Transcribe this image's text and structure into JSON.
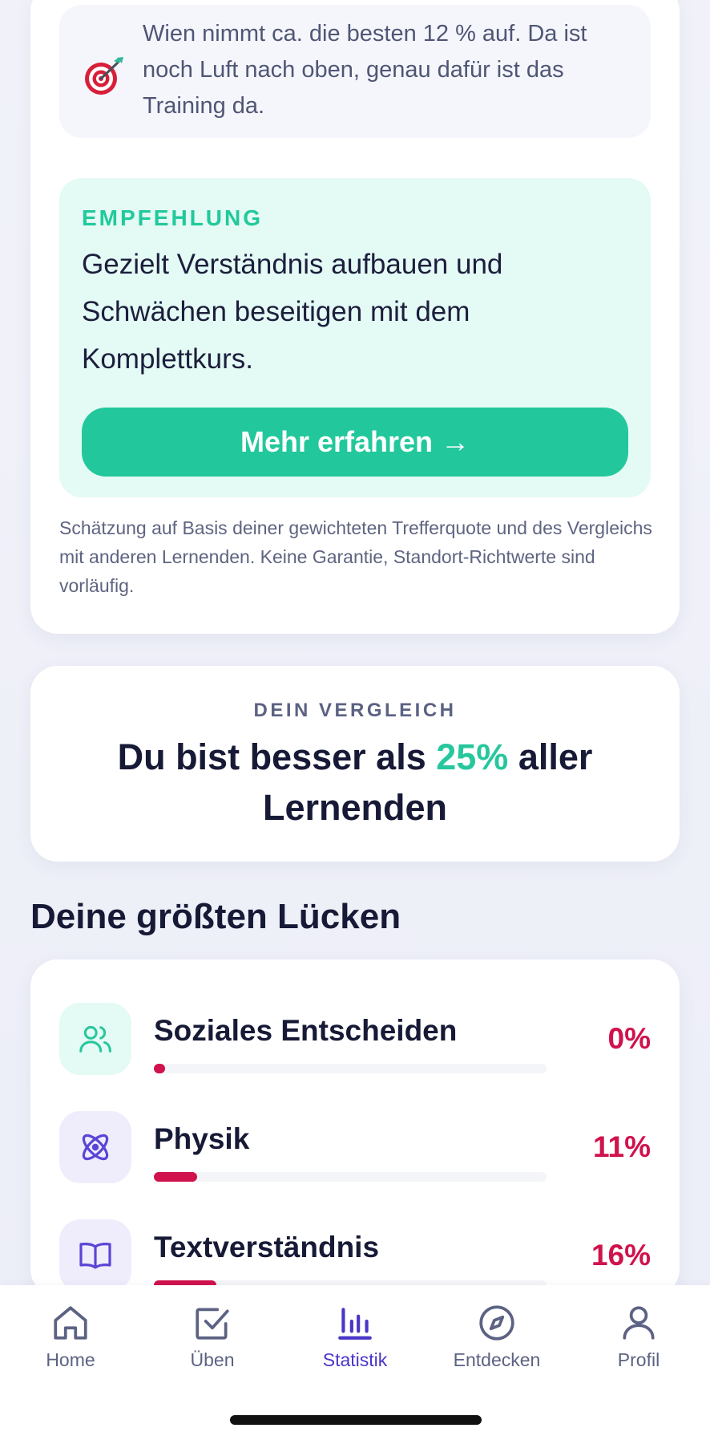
{
  "info": {
    "text": "Wien nimmt ca. die besten 12 % auf. Da ist noch Luft nach oben, genau dafür ist das Training da.",
    "icon": "target-icon"
  },
  "recommendation": {
    "label": "EMPFEHLUNG",
    "text": "Gezielt Verständnis aufbauen und Schwächen beseitigen mit dem Komplettkurs.",
    "button_label": "Mehr erfahren →"
  },
  "disclaimer": "Schätzung auf Basis deiner gewichteten Trefferquote und des Vergleichs mit anderen Lernenden. Keine Garantie, Standort-Richtwerte sind vorläufig.",
  "comparison": {
    "label": "DEIN VERGLEICH",
    "text_before": "Du bist besser als ",
    "percent": "25%",
    "text_after": " aller Lernenden"
  },
  "gaps": {
    "title": "Deine größten Lücken",
    "items": [
      {
        "name": "Soziales Entscheiden",
        "percent_label": "0%",
        "value": 0,
        "icon": "users-icon"
      },
      {
        "name": "Physik",
        "percent_label": "11%",
        "value": 11,
        "icon": "atom-icon"
      },
      {
        "name": "Textverständnis",
        "percent_label": "16%",
        "value": 16,
        "icon": "book-icon"
      }
    ]
  },
  "nav": {
    "items": [
      {
        "label": "Home",
        "icon": "home-icon"
      },
      {
        "label": "Üben",
        "icon": "checkbox-icon"
      },
      {
        "label": "Statistik",
        "icon": "bar-chart-icon",
        "active": true
      },
      {
        "label": "Entdecken",
        "icon": "compass-icon"
      },
      {
        "label": "Profil",
        "icon": "user-icon"
      }
    ]
  },
  "colors": {
    "accent": "#22c89c",
    "danger": "#d0124d",
    "active_nav": "#4a36c8"
  }
}
